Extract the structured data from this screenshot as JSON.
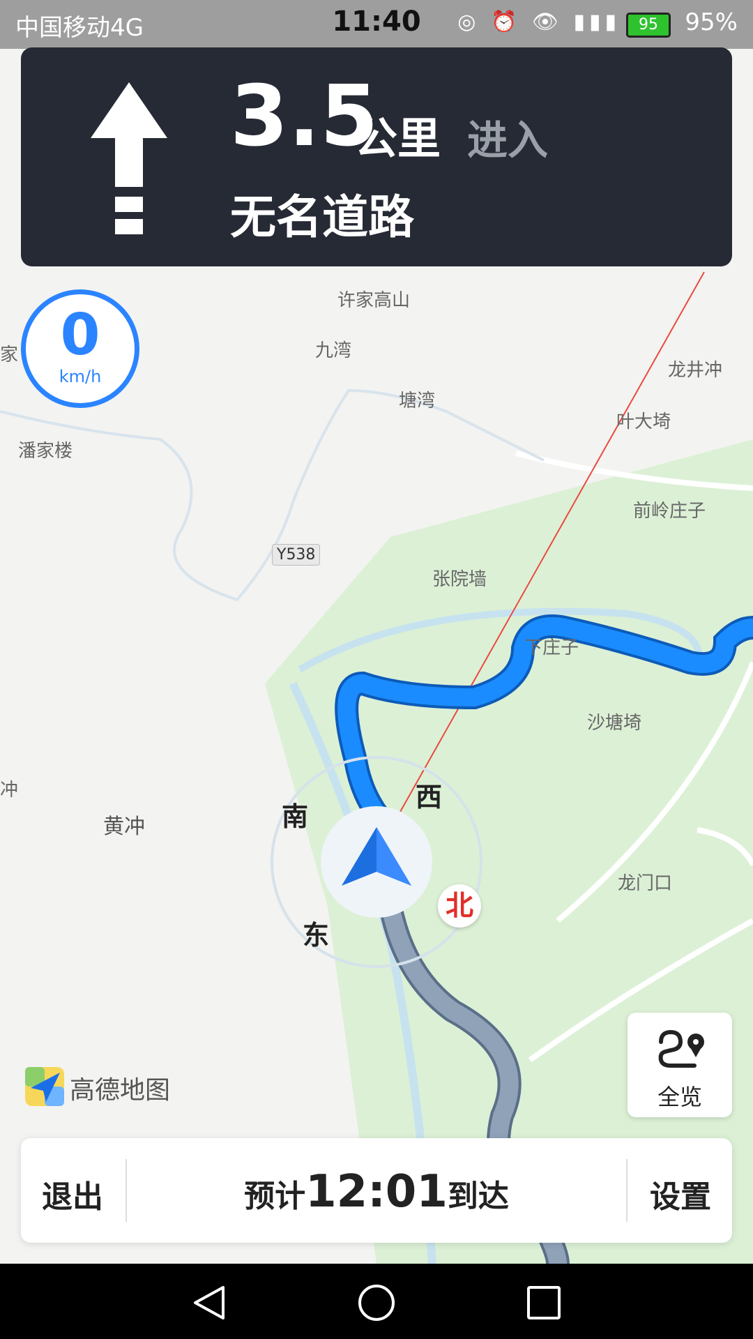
{
  "status_bar": {
    "carrier": "中国移动4G",
    "time": "11:40",
    "battery": "95",
    "battery_pct": "95%"
  },
  "nav_card": {
    "distance": "3.5",
    "unit": "公里",
    "action": "进入",
    "road_name": "无名道路",
    "turn_icon": "straight-arrow-icon"
  },
  "speed": {
    "value": "0",
    "unit": "km/h"
  },
  "map": {
    "places": {
      "xujiagaoshan": "许家高山",
      "jiuwan": "九湾",
      "tangwan": "塘湾",
      "longjingchong": "龙井冲",
      "yedayi": "叶大埼",
      "panjialou": "潘家楼",
      "qianlingzhuangzi": "前岭庄子",
      "zhangyuanqiang": "张院墙",
      "xiazhuangzi": "下庄子",
      "shatangqi": "沙塘埼",
      "huangchong": "黄冲",
      "longmenkou": "龙门口",
      "left_chong": "冲",
      "left_jia": "家"
    },
    "road_badge": "Y538"
  },
  "compass": {
    "south": "南",
    "west": "西",
    "east": "东",
    "north": "北"
  },
  "overview": {
    "label": "全览"
  },
  "logo": {
    "text": "高德地图"
  },
  "bottom_bar": {
    "exit": "退出",
    "eta_prefix": "预计",
    "eta_time": "12:01",
    "eta_suffix": "到达",
    "settings": "设置"
  },
  "colors": {
    "route": "#1a8cff",
    "route_passed": "#7f92a8",
    "card": "#262a34",
    "accent": "#2b84ff"
  }
}
